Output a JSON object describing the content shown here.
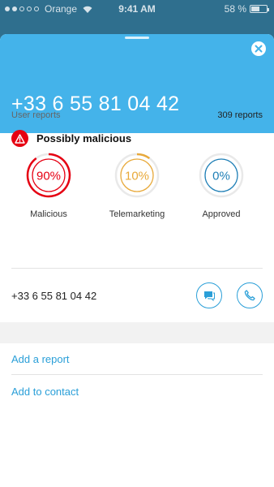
{
  "status_bar": {
    "carrier": "Orange",
    "time": "9:41 AM",
    "battery": "58 %",
    "signal_bars_filled": 2,
    "signal_bars_total": 5
  },
  "header": {
    "phone_number": "+33 6 55 81 04 42",
    "close_icon": "close-icon"
  },
  "reports": {
    "title": "User reports",
    "count_label": "309 reports"
  },
  "warning": {
    "label": "Possibly malicious",
    "icon": "warning-icon",
    "color": "#e60012"
  },
  "gauges": [
    {
      "label": "Malicious",
      "value_text": "90%",
      "value": 90,
      "color": "#e60012"
    },
    {
      "label": "Telemarketing",
      "value_text": "10%",
      "value": 10,
      "color": "#e8a93a"
    },
    {
      "label": "Approved",
      "value_text": "0%",
      "value": 0,
      "color": "#1f7fb6"
    }
  ],
  "contact": {
    "phone_number": "+33 6 55 81 04 42",
    "message_icon": "message-icon",
    "call_icon": "phone-icon"
  },
  "actions": {
    "add_report": "Add a report",
    "add_contact": "Add to contact"
  },
  "colors": {
    "accent": "#44b3ea",
    "link": "#2a9fd8"
  }
}
